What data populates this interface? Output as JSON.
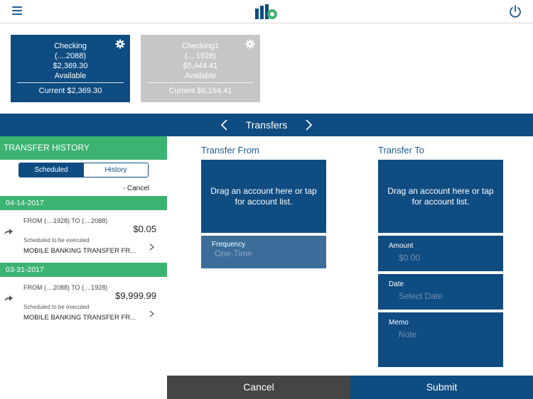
{
  "header": {
    "menu_icon": "hamburger-menu-icon",
    "logo_icon": "bank-logo-icon",
    "power_icon": "power-icon"
  },
  "accounts": [
    {
      "name": "Checking",
      "number": "(....2088)",
      "available_amount": "$2,369.30",
      "available_label": "Available",
      "current": "Current $2,369.30"
    },
    {
      "name": "Checking1",
      "number": "(....1928)",
      "available_amount": "$5,444.41",
      "available_label": "Available",
      "current": "Current $6,194.41"
    }
  ],
  "nav": {
    "title": "Transfers"
  },
  "history": {
    "header": "TRANSFER HISTORY",
    "tabs": [
      "Scheduled",
      "History"
    ],
    "cancel_link": "- Cancel",
    "groups": [
      {
        "date": "04-14-2017",
        "from_to": "FROM  (....1928)  TO  (....2088)",
        "amount": "$0.05",
        "status": "Scheduled to be executed",
        "memo": "MOBILE BANKING TRANSFER FR..."
      },
      {
        "date": "03-31-2017",
        "from_to": "FROM  (....2088)  TO  (....1928)",
        "amount": "$9,999.99",
        "status": "Scheduled to be executed",
        "memo": "MOBILE BANKING TRANSFER FR..."
      }
    ]
  },
  "transfer": {
    "from_title": "Transfer From",
    "to_title": "Transfer To",
    "drop_text": "Drag an account here or tap for account list.",
    "frequency_label": "Frequency",
    "frequency_value": "One-Time",
    "amount_label": "Amount",
    "amount_placeholder": "$0.00",
    "date_label": "Date",
    "date_placeholder": "Select Date",
    "memo_label": "Memo",
    "memo_placeholder": "Note"
  },
  "actions": {
    "cancel": "Cancel",
    "submit": "Submit"
  },
  "colors": {
    "primary": "#0f4c81",
    "accent_green": "#3cb371",
    "disabled_card": "#c6c6c6",
    "cancel_button": "#454545"
  }
}
